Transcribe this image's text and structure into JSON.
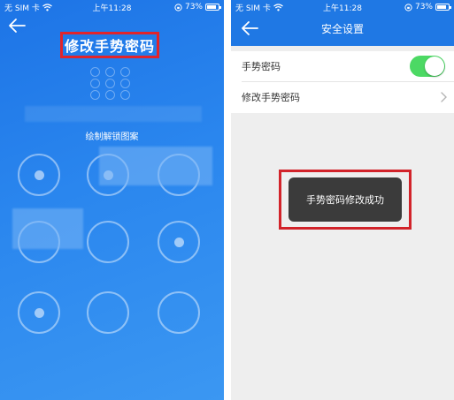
{
  "left_screen": {
    "status_bar": {
      "carrier": "无 SIM 卡",
      "time": "上午11:28",
      "battery": "73%",
      "battery_level": 0.73
    },
    "title": "修改手势密码",
    "hint": "绘制解锁图案",
    "accent_color": "#1d74e6",
    "highlight_color": "#e2242b"
  },
  "right_screen": {
    "status_bar": {
      "carrier": "无 SIM 卡",
      "time": "上午11:28",
      "battery": "73%",
      "battery_level": 0.73
    },
    "title": "安全设置",
    "settings": [
      {
        "label": "手势密码",
        "control": "toggle",
        "enabled": true
      },
      {
        "label": "修改手势密码",
        "control": "chevron"
      }
    ],
    "toast": "手势密码修改成功",
    "toggle_color": "#4cd964",
    "header_color": "#1f78e4"
  },
  "icons": {
    "back": "back-arrow-icon",
    "wifi": "wifi-icon",
    "battery": "battery-icon",
    "lock_rotation": "orientation-lock-icon",
    "chevron": "chevron-right-icon"
  }
}
